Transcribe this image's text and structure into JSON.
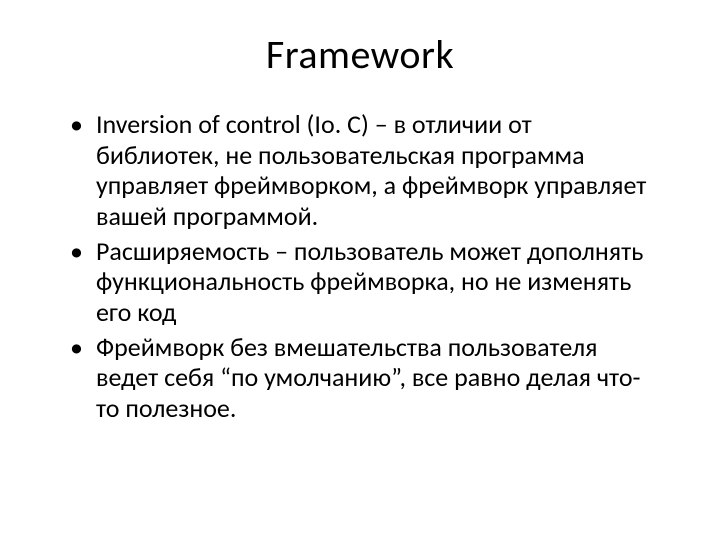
{
  "title": "Framework",
  "bullets": [
    "Inversion of control (Io. C) – в отличии от библиотек, не пользовательская программа управляет фреймворком, а фреймворк управляет вашей программой.",
    "Расширяемость – пользователь может дополнять функциональность фреймворка, но не изменять его код",
    "Фреймворк без вмешательства пользователя ведет себя “по умолчанию”, все равно делая что-то полезное."
  ]
}
